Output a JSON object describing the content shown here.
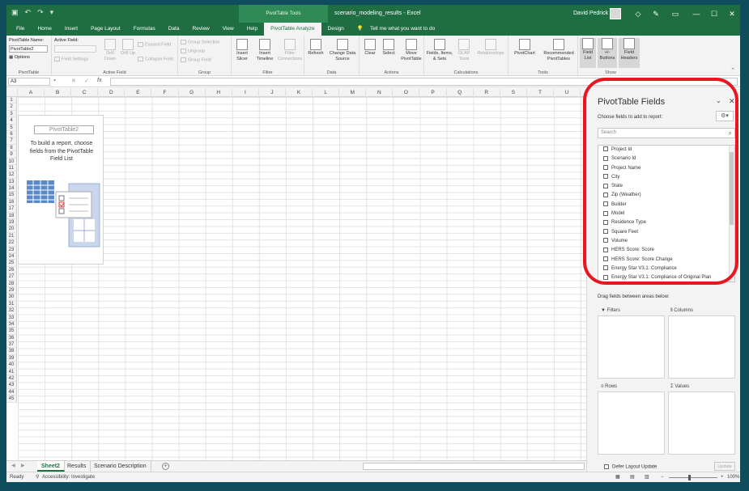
{
  "title_bar": {
    "context_tab": "PivotTable Tools",
    "document": "scenario_modeling_results - Excel",
    "user": "David Pedrick",
    "minimize": "—",
    "restore": "☐",
    "close": "✕"
  },
  "ribbon_tabs": [
    "File",
    "Home",
    "Insert",
    "Page Layout",
    "Formulas",
    "Data",
    "Review",
    "View",
    "Help",
    "PivotTable Analyze",
    "Design"
  ],
  "active_tab": "PivotTable Analyze",
  "tell_me": "Tell me what you want to do",
  "ribbon": {
    "pivottable_group": {
      "name_label": "PivotTable Name:",
      "name_value": "PivotTable2",
      "options": "Options",
      "group": "PivotTable"
    },
    "active_field_group": {
      "label": "Active Field:",
      "field_settings": "Field Settings",
      "drill_down": "Drill Down",
      "drill_up": "Drill Up",
      "expand": "Expand Field",
      "collapse": "Collapse Field",
      "group": "Active Field"
    },
    "group_group": {
      "selection": "Group Selection",
      "ungroup": "Ungroup",
      "field": "Group Field",
      "group": "Group"
    },
    "filter_group": {
      "slicer": "Insert Slicer",
      "timeline": "Insert Timeline",
      "connections": "Filter Connections",
      "group": "Filter"
    },
    "data_group": {
      "refresh": "Refresh",
      "change_source": "Change Data Source",
      "group": "Data"
    },
    "actions_group": {
      "clear": "Clear",
      "select": "Select",
      "move": "Move PivotTable",
      "group": "Actions"
    },
    "calc_group": {
      "fields_items": "Fields, Items, & Sets",
      "olap": "OLAP Tools",
      "relationships": "Relationships",
      "group": "Calculations"
    },
    "tools_group": {
      "pivotchart": "PivotChart",
      "recommended": "Recommended PivotTables",
      "group": "Tools"
    },
    "show_group": {
      "field_list": "Field List",
      "buttons": "+/- Buttons",
      "headers": "Field Headers",
      "group": "Show"
    }
  },
  "formula_bar": {
    "name_box": "A3",
    "fx": "fx",
    "cancel": "✕",
    "enter": "✓",
    "value": ""
  },
  "columns": [
    "A",
    "B",
    "C",
    "D",
    "E",
    "F",
    "G",
    "H",
    "I",
    "J",
    "K",
    "L",
    "M",
    "N",
    "O",
    "P",
    "Q",
    "R",
    "S",
    "T",
    "U"
  ],
  "rows": [
    "1",
    "2",
    "3",
    "4",
    "5",
    "6",
    "7",
    "8",
    "9",
    "10",
    "11",
    "12",
    "13",
    "14",
    "15",
    "16",
    "17",
    "18",
    "19",
    "20",
    "21",
    "22",
    "23",
    "24",
    "25",
    "26",
    "27",
    "28",
    "29",
    "30",
    "31",
    "32",
    "33",
    "34",
    "35",
    "36",
    "37",
    "38",
    "39",
    "40",
    "41",
    "42",
    "43",
    "44",
    "45"
  ],
  "pivot_placeholder": {
    "name": "PivotTable2",
    "message": "To build a report, choose fields from the PivotTable Field List"
  },
  "sheets": [
    "Sheet2",
    "Results",
    "Scenario Description"
  ],
  "active_sheet": "Sheet2",
  "status": {
    "ready": "Ready",
    "accessibility": "Accessibility: Investigate",
    "zoom": "100%"
  },
  "pane": {
    "title": "PivotTable Fields",
    "choose": "Choose fields to add to report:",
    "search_placeholder": "Search",
    "fields": [
      "Project Id",
      "Scenario Id",
      "Project Name",
      "City",
      "State",
      "Zip (Weather)",
      "Builder",
      "Model",
      "Residence Type",
      "Square Feet",
      "Volume",
      "HERS Score: Score",
      "HERS Score: Score Change",
      "Energy Star V3.1: Compliance",
      "Energy Star V3.1: Compliance of Original Plan"
    ],
    "drag_label": "Drag fields between areas below:",
    "areas": {
      "filters": "Filters",
      "columns": "Columns",
      "rows": "Rows",
      "values": "Values"
    },
    "defer": "Defer Layout Update",
    "update": "Update"
  },
  "accent_color": "#1e6e42",
  "highlight_color": "#e8171f"
}
